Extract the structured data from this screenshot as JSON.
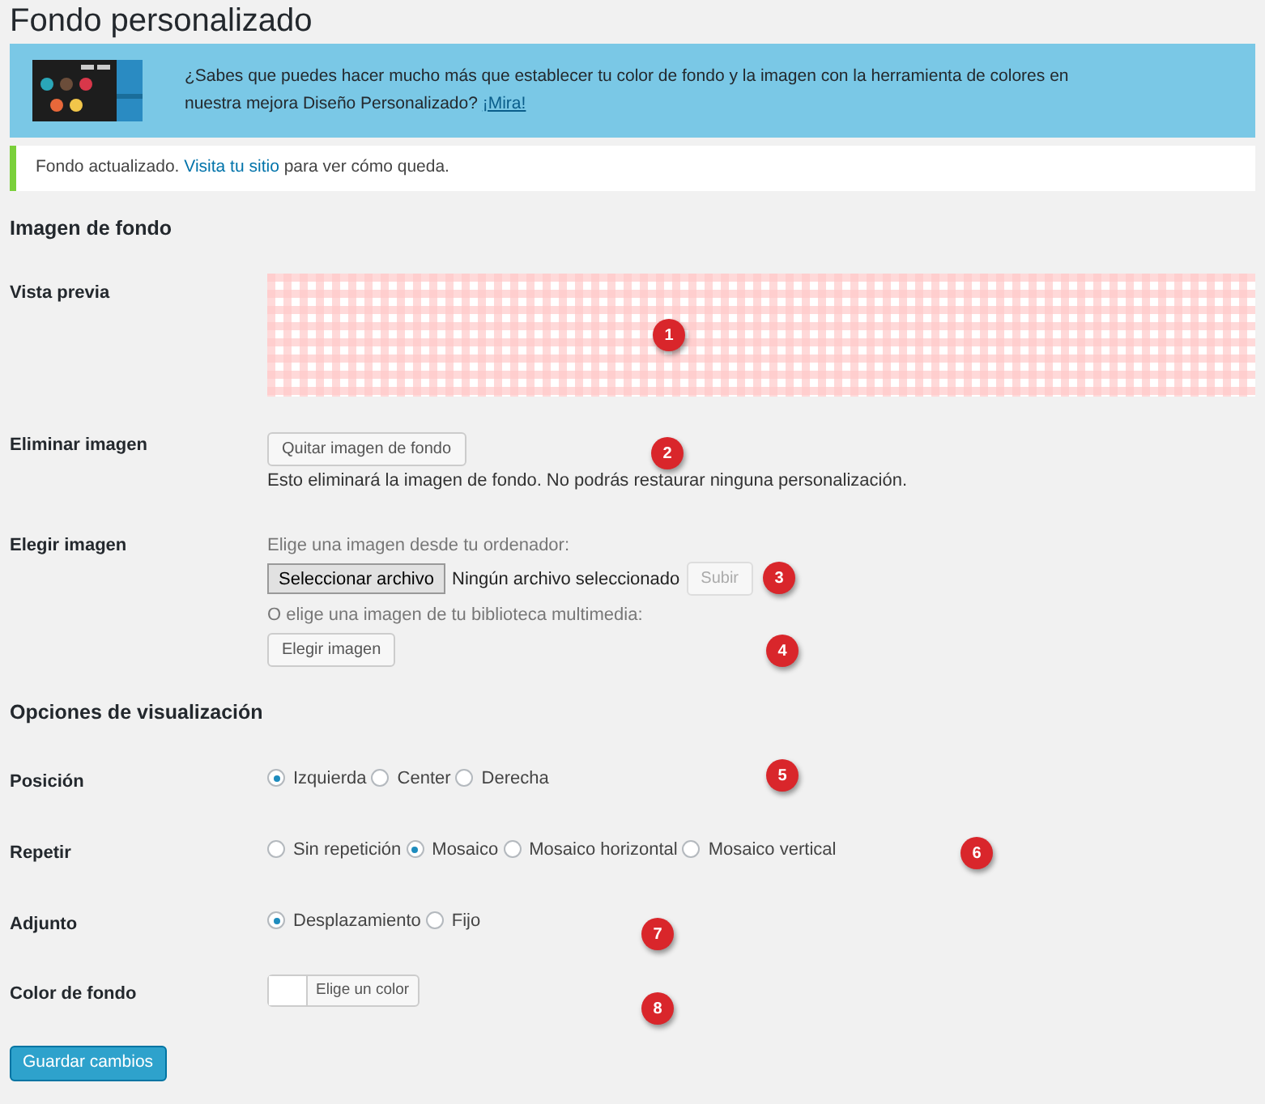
{
  "title": "Fondo personalizado",
  "promo": {
    "text": "¿Sabes que puedes hacer mucho más que establecer tu color de fondo y la imagen con la herramienta de colores en nuestra mejora Diseño Personalizado?",
    "link": "¡Mira!"
  },
  "notice": {
    "before": "Fondo actualizado.",
    "link": "Visita tu sitio",
    "after": "para ver cómo queda."
  },
  "sections": [
    {
      "heading": "Imagen de fondo",
      "rows": [
        {
          "kind": "preview",
          "label": "Vista previa"
        },
        {
          "kind": "remove",
          "label": "Eliminar imagen",
          "button": "Quitar imagen de fondo",
          "note": "Esto eliminará la imagen de fondo. No podrás restaurar ninguna personalización."
        },
        {
          "kind": "choose",
          "label": "Elegir imagen",
          "hint": "Elige una imagen desde tu ordenador:",
          "file_button": "Seleccionar archivo",
          "file_status": "Ningún archivo seleccionado",
          "upload": {
            "label": "Subir",
            "disabled": true
          },
          "library_hint": "O elige una imagen de tu biblioteca multimedia:",
          "library_button": "Elegir imagen"
        }
      ]
    },
    {
      "heading": "Opciones de visualización",
      "rows": [
        {
          "kind": "radio",
          "label": "Posición",
          "options": [
            {
              "label": "Izquierda",
              "selected": true
            },
            {
              "label": "Center",
              "selected": false
            },
            {
              "label": "Derecha",
              "selected": false
            }
          ]
        },
        {
          "kind": "radio",
          "label": "Repetir",
          "options": [
            {
              "label": "Sin repetición",
              "selected": false
            },
            {
              "label": "Mosaico",
              "selected": true
            },
            {
              "label": "Mosaico horizontal",
              "selected": false
            },
            {
              "label": "Mosaico vertical",
              "selected": false
            }
          ]
        },
        {
          "kind": "radio",
          "label": "Adjunto",
          "options": [
            {
              "label": "Desplazamiento",
              "selected": true
            },
            {
              "label": "Fijo",
              "selected": false
            }
          ]
        },
        {
          "kind": "color",
          "label": "Color de fondo",
          "button": "Elige un color"
        }
      ]
    }
  ],
  "save_button": "Guardar cambios",
  "markers": [
    "1",
    "2",
    "3",
    "4",
    "5",
    "6",
    "7",
    "8"
  ]
}
